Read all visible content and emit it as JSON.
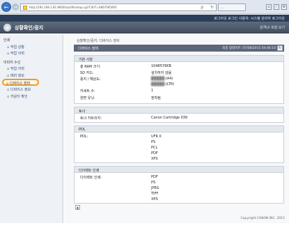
{
  "browser": {
    "url": "http://192.168.1.81:8000/rps/dfssetup.cgi?CSUT=4867065093",
    "search_glyph": "ρ",
    "refresh_glyph": "↻",
    "tab_label": "...",
    "back_glyph": "←",
    "forward_glyph": "→",
    "window_icons": [
      "⌂",
      "☆",
      "⚙"
    ]
  },
  "header": {
    "topbar_text": "로그아웃   로그인 사용자: 시스템 관리자 로그아웃",
    "app_title": "상황확인/중지",
    "portal_link": "원격UI 포털 보기"
  },
  "sidebar": {
    "sections": [
      {
        "title": "인쇄",
        "items": [
          "작업 상황",
          "작업 이력"
        ]
      },
      {
        "title": "이미지 수신",
        "items": [
          "작업 이력"
        ]
      }
    ],
    "misc_items": [
      "에러 정보",
      "디바이스 장비",
      "디바이스 정보",
      "카운터 확인"
    ],
    "selected_item": "디바이스 장비"
  },
  "main": {
    "breadcrumb": "상황확인/중지: 디바이스 장비",
    "panel_title": "디바이스 장비",
    "last_updated": "최종 업데이트: 07/08/2015 04:46:10",
    "refresh_glyph": "↻",
    "basic": {
      "title": "기본 사양",
      "rows": [
        {
          "label": "총 RAM 크기:",
          "value": "1048576KB"
        },
        {
          "label": "SD 카드:",
          "value": "설치하지 않음"
        },
        {
          "label": "용지 / 해상도:",
          "value": "(A4)",
          "value2": "(LTR)"
        },
        {
          "label": "카세트 수:",
          "value": "1"
        },
        {
          "label": "양면 유닛:",
          "value": "장착됨"
        }
      ]
    },
    "toner": {
      "title": "토너",
      "rows": [
        {
          "label": "토너 카트리지:",
          "value": "Canon Cartridge 039"
        }
      ]
    },
    "pdl": {
      "title": "PDL",
      "label": "PDL:",
      "values": [
        "UFR II",
        "PS",
        "PCL",
        "PDF",
        "XPS"
      ]
    },
    "direct_print": {
      "title": "다이렉트 인쇄",
      "label": "다이렉트 인쇄:",
      "values": [
        "PDF",
        "PS",
        "JPEG",
        "TIFF",
        "XPS"
      ]
    }
  },
  "footer": {
    "copyright": "Copyright CANON INC. 2015"
  }
}
